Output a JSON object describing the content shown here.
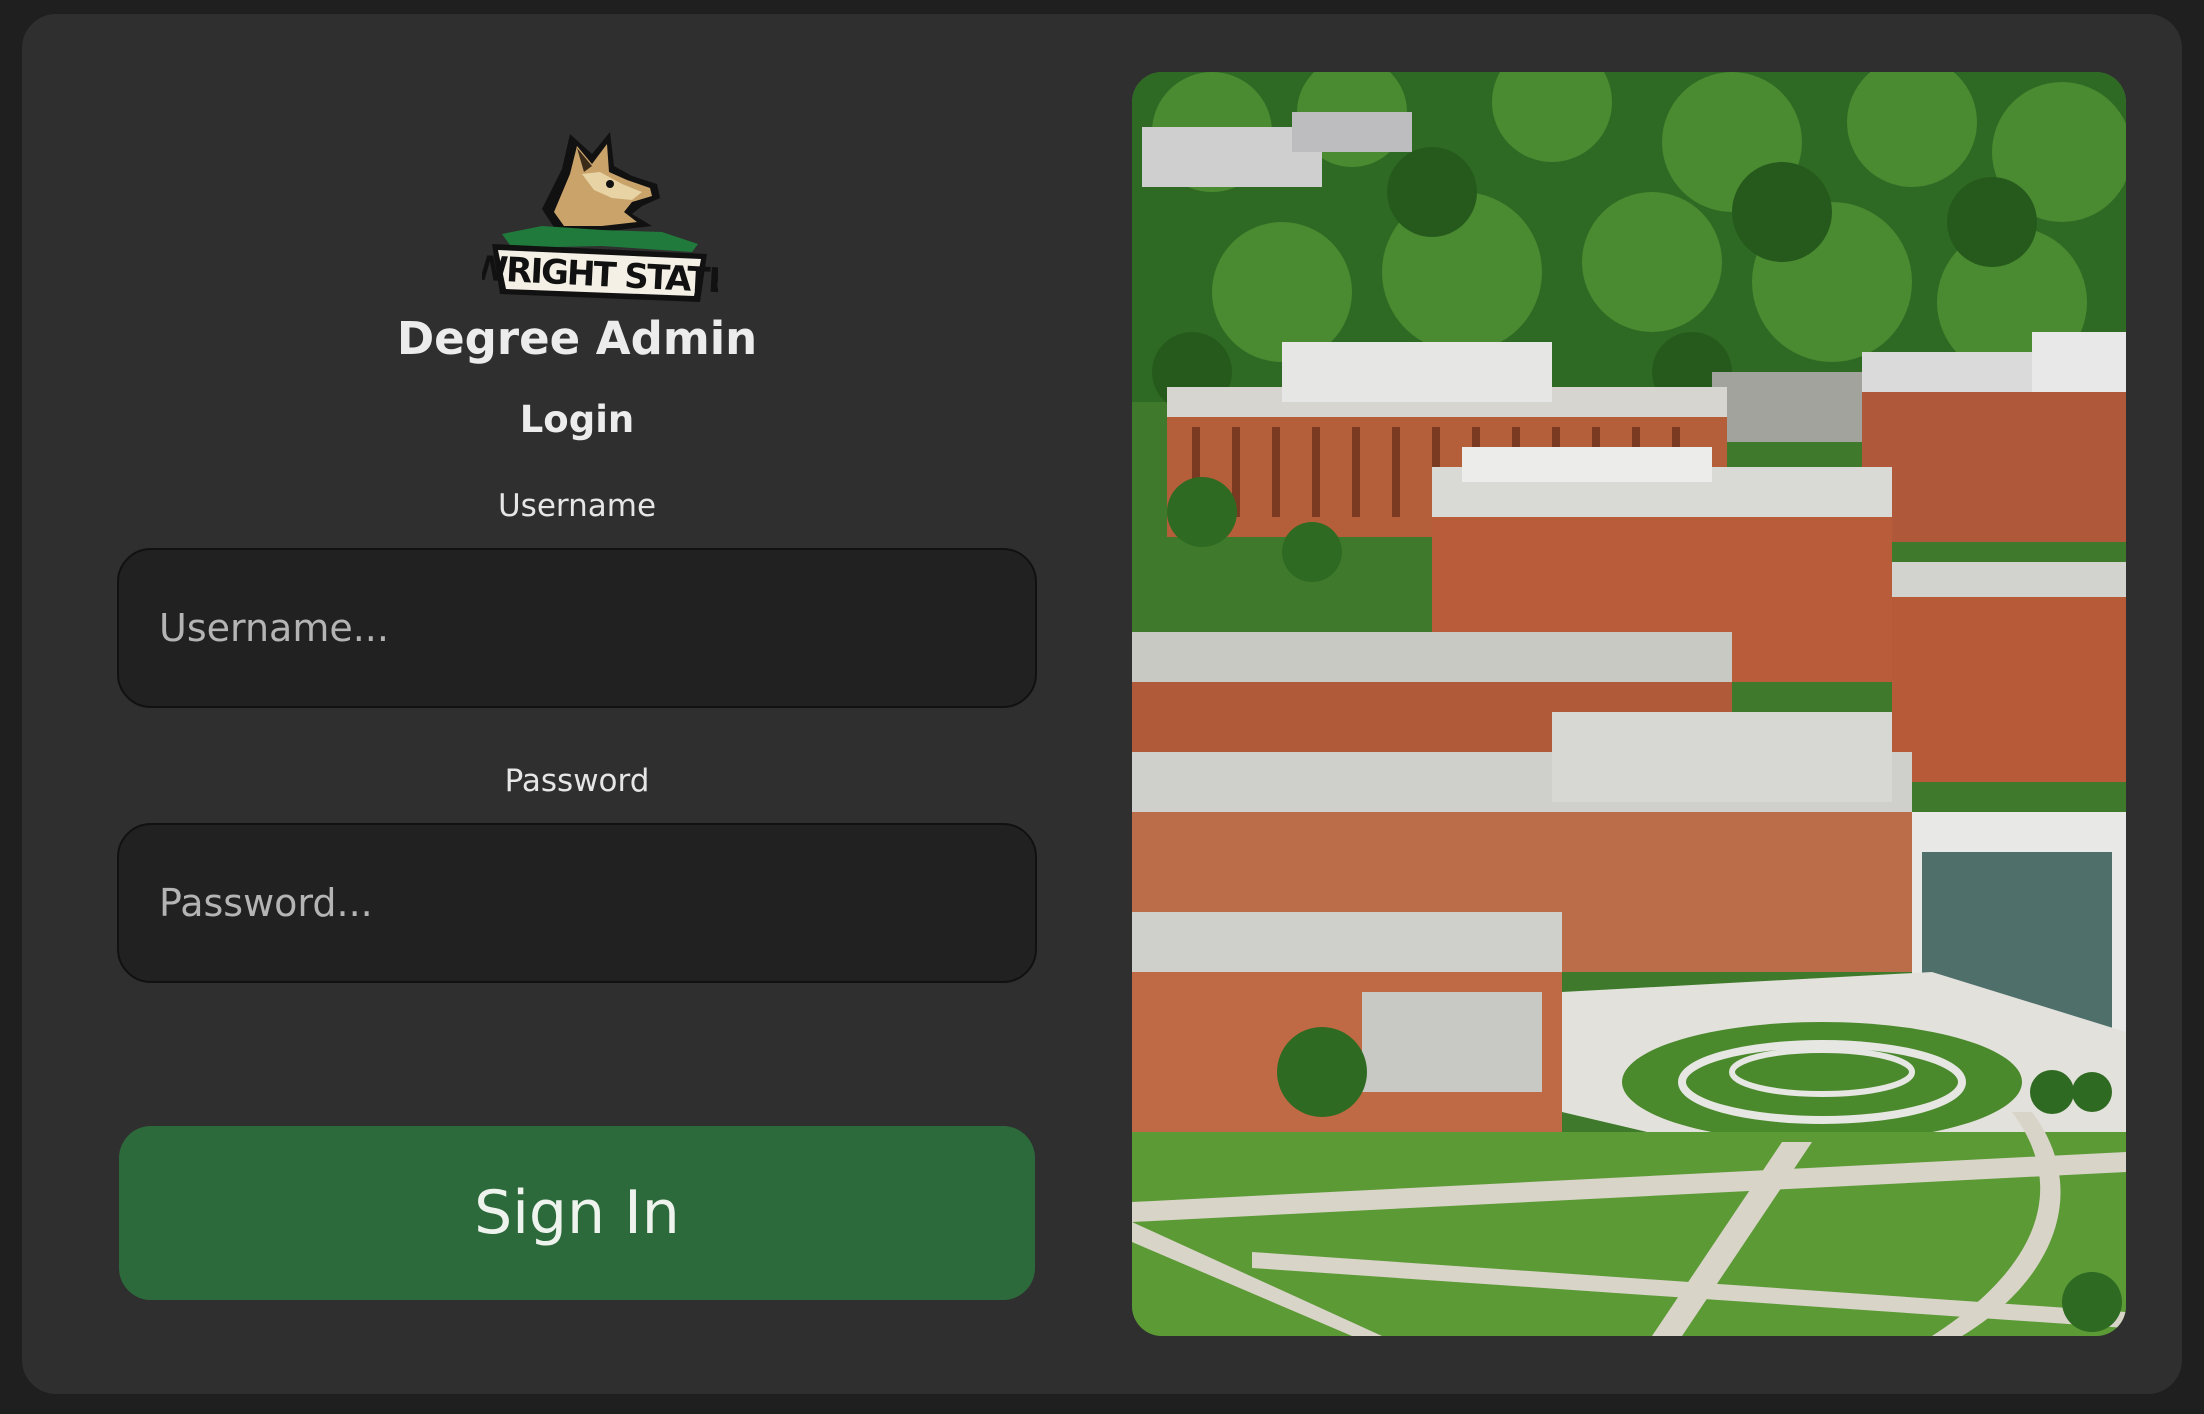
{
  "app": {
    "title": "Degree Admin",
    "logo_text": "WRIGHT STATE"
  },
  "login": {
    "heading": "Login",
    "username_label": "Username",
    "username_placeholder": "Username...",
    "password_label": "Password",
    "password_placeholder": "Password...",
    "sign_in_label": "Sign In"
  },
  "colors": {
    "background": "#1f1f1f",
    "card": "#2f2f2f",
    "input": "#212121",
    "button": "#2d6a3b"
  }
}
